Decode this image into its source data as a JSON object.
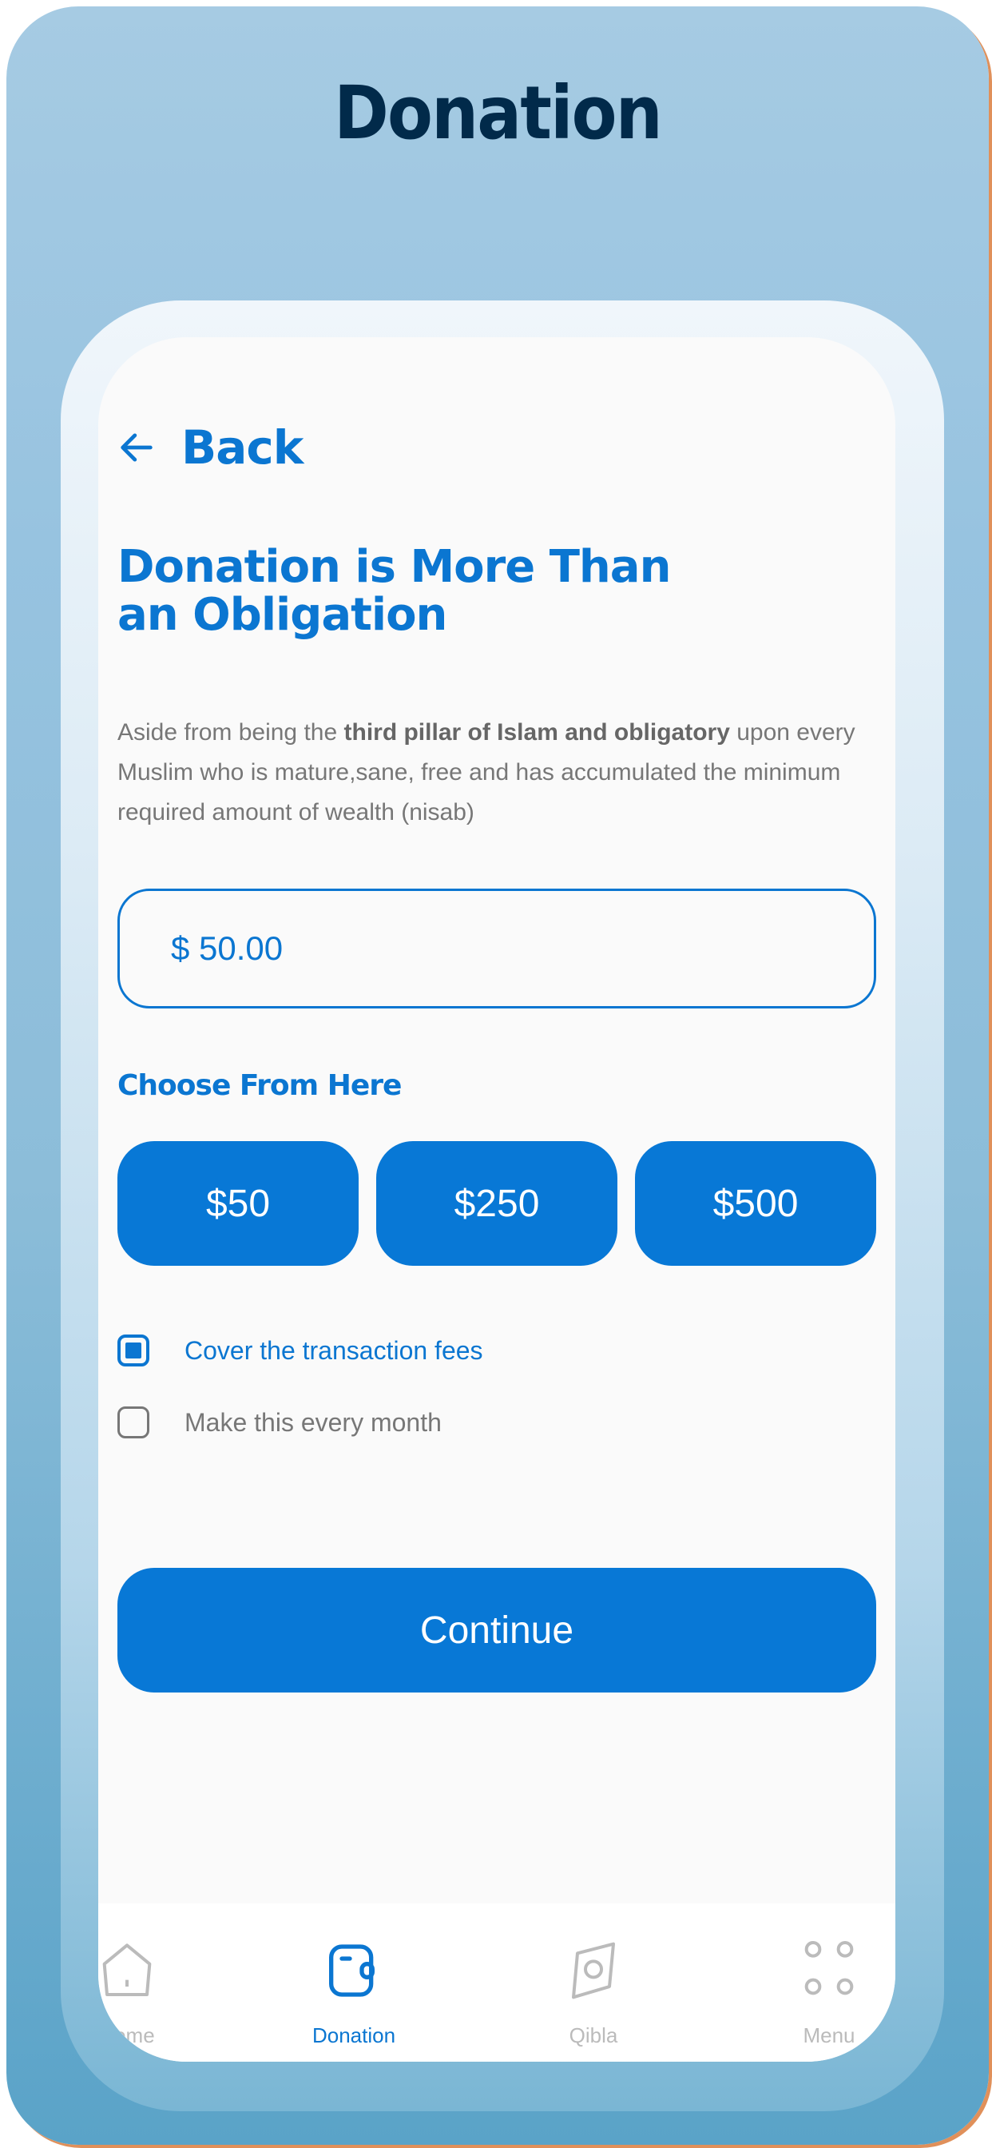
{
  "header": {
    "title": "Donation"
  },
  "screen": {
    "back_label": "Back",
    "heading": "Donation is More Than an Obligation",
    "description": {
      "prefix": "Aside from being the ",
      "bold": "third pillar of Islam and obligatory",
      "suffix": " upon every Muslim who is mature,sane, free and has accumulated the minimum required amount of wealth (nisab)"
    },
    "amount_input": {
      "value": "$ 50.00"
    },
    "choose_label": "Choose From Here",
    "preset_amounts": [
      {
        "label": "$50"
      },
      {
        "label": "$250"
      },
      {
        "label": "$500"
      }
    ],
    "options": [
      {
        "label": "Cover the transaction fees",
        "checked": true
      },
      {
        "label": "Make this every month",
        "checked": false
      }
    ],
    "continue_label": "Continue"
  },
  "tabbar": {
    "items": [
      {
        "label": "Home",
        "icon": "home-icon",
        "active": false
      },
      {
        "label": "Donation",
        "icon": "wallet-icon",
        "active": true
      },
      {
        "label": "Qibla",
        "icon": "compass-icon",
        "active": false
      },
      {
        "label": "Menu",
        "icon": "grid-dots-icon",
        "active": false
      }
    ]
  },
  "colors": {
    "accent": "#0B76D1",
    "title_dark": "#012A4A",
    "muted_text": "#777777",
    "inactive_tab": "#BBBBBB"
  }
}
